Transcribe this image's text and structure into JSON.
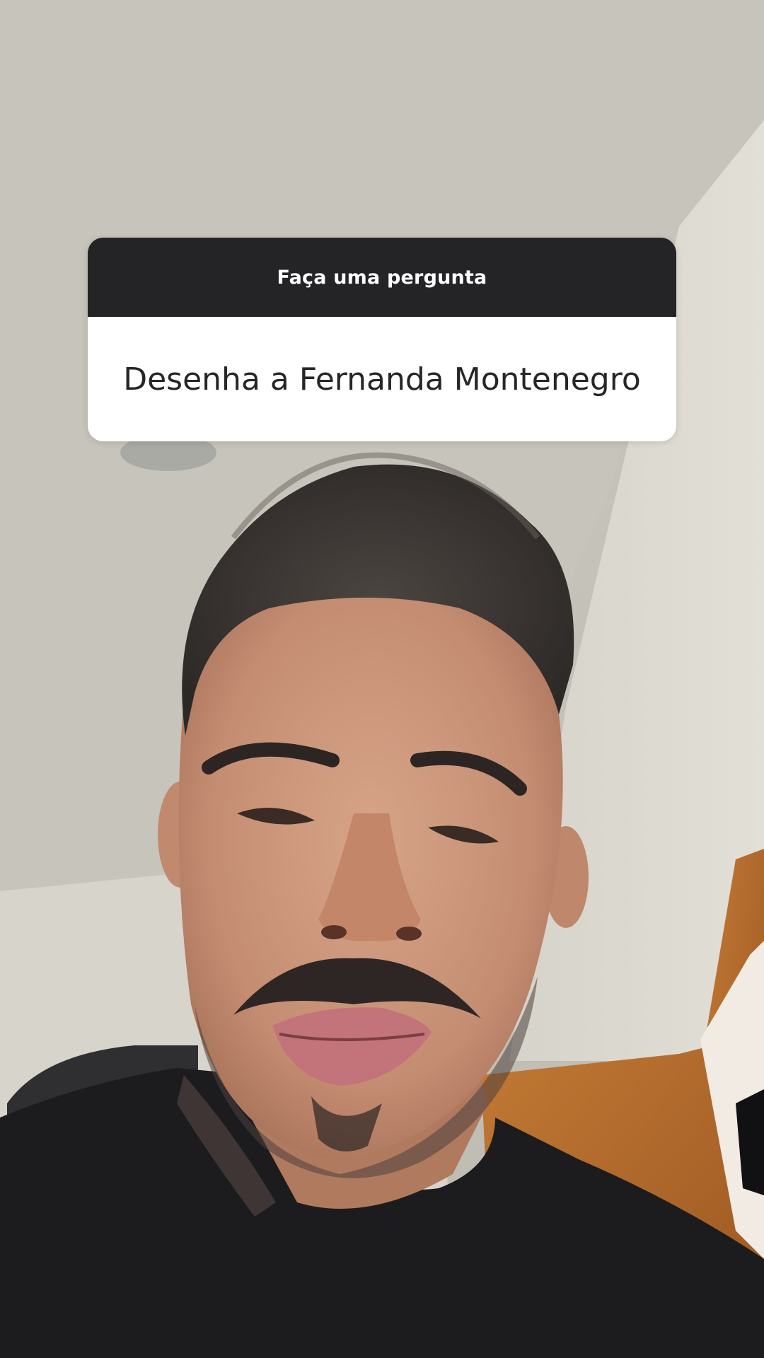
{
  "question_sticker": {
    "header_label": "Faça uma pergunta",
    "question_text": "Desenha a Fernanda Montenegro"
  },
  "colors": {
    "sticker_header_bg": "#242427",
    "sticker_body_bg": "#ffffff",
    "sticker_text": "#262626",
    "wall": "#d0cdc4",
    "shirt": "#1b1b1d",
    "door_wood": "#b66a2c"
  }
}
